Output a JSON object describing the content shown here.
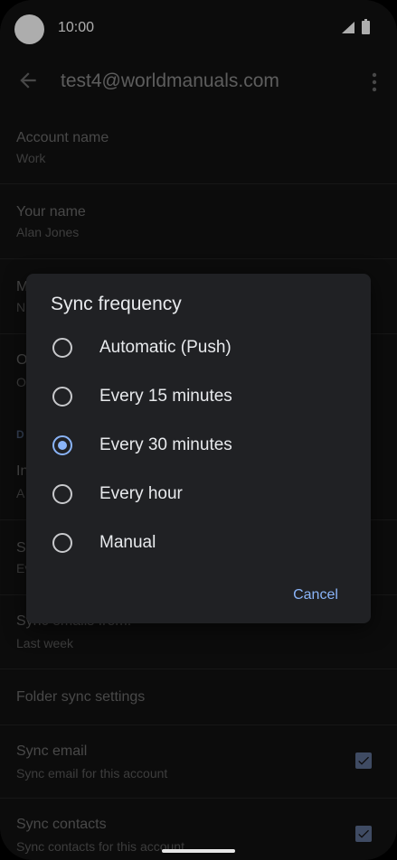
{
  "status_bar": {
    "time": "10:00"
  },
  "app_bar": {
    "title": "test4@worldmanuals.com"
  },
  "settings": {
    "account_name": {
      "title": "Account name",
      "value": "Work"
    },
    "your_name": {
      "title": "Your name",
      "value": "Alan Jones"
    },
    "partial_row_1": {
      "title": "M",
      "value": "N"
    },
    "partial_row_2": {
      "title": "O",
      "value": "O"
    },
    "section_header": "D",
    "partial_row_3": {
      "title": "In",
      "value": "A"
    },
    "partial_row_4": {
      "title": "S",
      "value": "Ev"
    },
    "sync_emails_from": {
      "title": "Sync emails from:",
      "value": "Last week"
    },
    "folder_sync": {
      "title": "Folder sync settings"
    },
    "sync_email": {
      "title": "Sync email",
      "value": "Sync email for this account",
      "checked": true
    },
    "sync_contacts": {
      "title": "Sync contacts",
      "value": "Sync contacts for this account",
      "checked": true
    }
  },
  "dialog": {
    "title": "Sync frequency",
    "options": [
      {
        "label": "Automatic (Push)",
        "selected": false
      },
      {
        "label": "Every 15 minutes",
        "selected": false
      },
      {
        "label": "Every 30 minutes",
        "selected": true
      },
      {
        "label": "Every hour",
        "selected": false
      },
      {
        "label": "Manual",
        "selected": false
      }
    ],
    "cancel_label": "Cancel"
  },
  "colors": {
    "accent": "#8ab4f8",
    "dialog_bg": "#202124",
    "screen_bg": "#131313"
  },
  "icons": [
    "back-arrow-icon",
    "more-vert-icon",
    "signal-icon",
    "battery-icon",
    "check-icon"
  ]
}
